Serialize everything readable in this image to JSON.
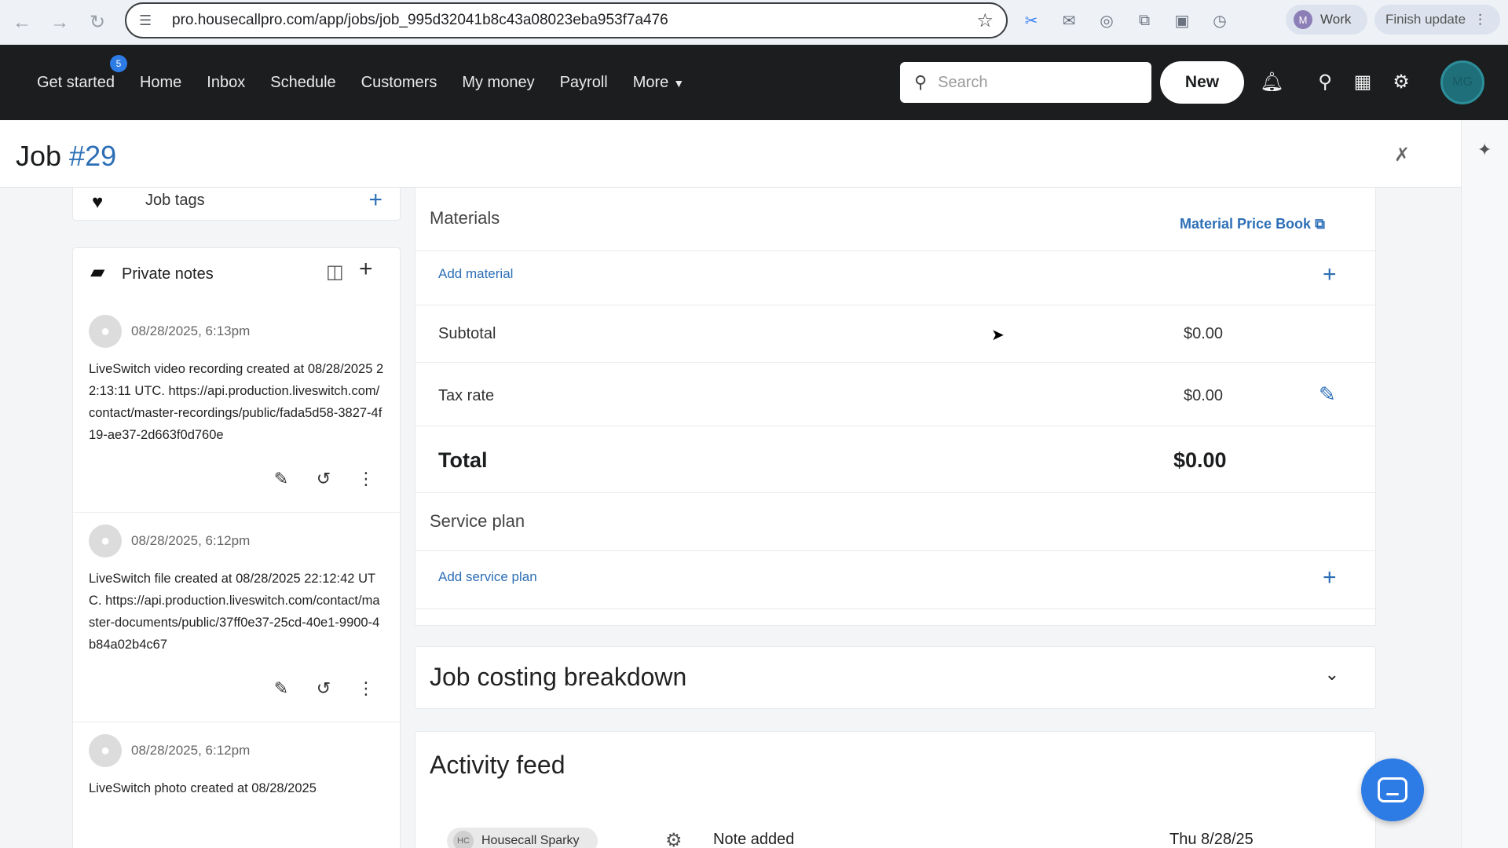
{
  "browser": {
    "url": "pro.housecallpro.com/app/jobs/job_995d32041b8c43a08023eba953f7a476",
    "profile_initial": "M",
    "profile_label": "Work",
    "update_label": "Finish update"
  },
  "nav": {
    "items": [
      {
        "label": "Get started",
        "badge": "5"
      },
      {
        "label": "Home"
      },
      {
        "label": "Inbox"
      },
      {
        "label": "Schedule"
      },
      {
        "label": "Customers"
      },
      {
        "label": "My money"
      },
      {
        "label": "Payroll"
      },
      {
        "label": "More"
      }
    ],
    "search_placeholder": "Search",
    "new_label": "New",
    "avatar_initials": "MG"
  },
  "page": {
    "title": "Job",
    "job_number": "#29"
  },
  "sidebar": {
    "job_tags_label": "Job tags",
    "private_notes_label": "Private notes",
    "notes": [
      {
        "date": "08/28/2025, 6:13pm",
        "text": "LiveSwitch video recording created at 08/28/2025 22:13:11 UTC. https://api.production.liveswitch.com/contact/master-recordings/public/fada5d58-3827-4f19-ae37-2d663f0d760e"
      },
      {
        "date": "08/28/2025, 6:12pm",
        "text": "LiveSwitch file created at 08/28/2025 22:12:42 UTC. https://api.production.liveswitch.com/contact/master-documents/public/37ff0e37-25cd-40e1-9900-4b84a02b4c67"
      },
      {
        "date": "08/28/2025, 6:12pm",
        "text": "LiveSwitch photo created at 08/28/2025"
      }
    ]
  },
  "materials": {
    "title": "Materials",
    "price_book_label": "Material Price Book",
    "add_material_label": "Add material",
    "subtotal_label": "Subtotal",
    "subtotal_value": "$0.00",
    "tax_label": "Tax rate",
    "tax_value": "$0.00",
    "total_label": "Total",
    "total_value": "$0.00",
    "service_plan_title": "Service plan",
    "add_service_plan_label": "Add service plan"
  },
  "costing": {
    "title": "Job costing breakdown"
  },
  "activity": {
    "title": "Activity feed",
    "item": {
      "actor_initials": "HC",
      "actor": "Housecall Sparky",
      "text": "Note added",
      "date": "Thu 8/28/25"
    }
  },
  "colors": {
    "nav_bg": "#1b1d1f",
    "accent_blue": "#2d6fb6",
    "chat_blue": "#2d7be5"
  }
}
